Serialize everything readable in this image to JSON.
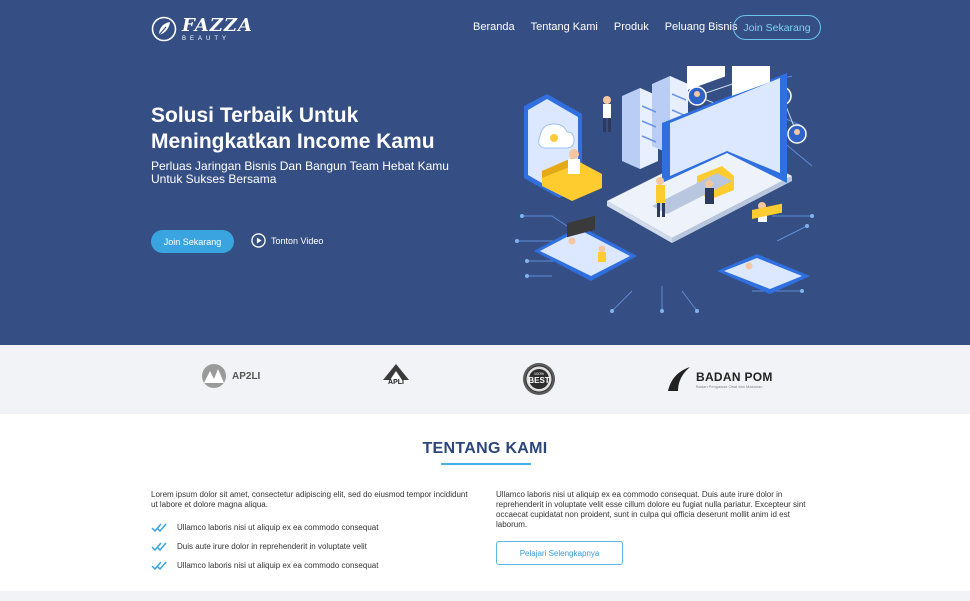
{
  "brand": {
    "name": "FAZZA",
    "tagline": "BEAUTY"
  },
  "nav": {
    "items": [
      "Beranda",
      "Tentang Kami",
      "Produk",
      "Peluang Bisnis"
    ],
    "cta": "Join Sekarang"
  },
  "hero": {
    "title": "Solusi Terbaik Untuk Meningkatkan Income Kamu",
    "subtitle": "Perluas Jaringan Bisnis Dan Bangun Team Hebat Kamu Untuk Sukses Bersama",
    "primary_button": "Join Sekarang",
    "video_button": "Tonton Video"
  },
  "partners": {
    "ap2li": {
      "name": "AP2LI"
    },
    "apli": {
      "name": "APLI"
    },
    "best": {
      "name": "BEST",
      "top": "100%"
    },
    "badan_pom": {
      "name": "BADAN POM",
      "sub": "Badan Pengawas Obat dan Makanan"
    }
  },
  "about": {
    "title": "TENTANG KAMI",
    "left_paragraph": "Lorem ipsum dolor sit amet, consectetur adipiscing elit, sed do eiusmod tempor incididunt ut labore et dolore magna aliqua.",
    "checks": [
      "Ullamco laboris nisi ut aliquip ex ea commodo consequat",
      "Duis aute irure dolor in reprehenderit in voluptate velit",
      "Ullamco laboris nisi ut aliquip ex ea commodo consequat"
    ],
    "right_paragraph": "Ullamco laboris nisi ut aliquip ex ea commodo consequat. Duis aute irure dolor in reprehenderit in voluptate velit esse cillum dolore eu fugiat nulla pariatur. Excepteur sint occaecat cupidatat non proident, sunt in culpa qui officia deserunt mollit anim id est laborum.",
    "more_button": "Pelajari Selengkapnya"
  },
  "colors": {
    "hero_bg": "#354f84",
    "accent": "#3aa4e0",
    "title": "#2c4679"
  }
}
